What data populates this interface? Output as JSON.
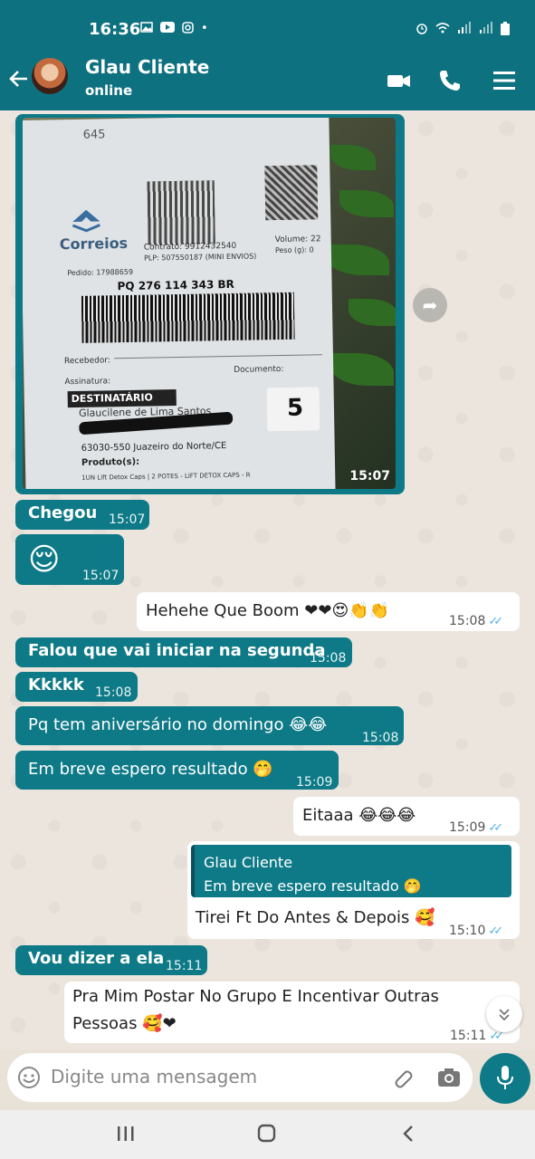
{
  "status_bar": {
    "time": "16:36",
    "notif_icons": [
      "image-icon",
      "youtube-icon",
      "instagram-icon"
    ],
    "dot": "•"
  },
  "header": {
    "contact_name": "Glau Cliente",
    "contact_status": "online"
  },
  "image_message": {
    "time": "15:07",
    "label_texts": {
      "brand": "Correios",
      "contract": "Contrato: 9912432540",
      "plp": "PLP: 507550187 (MINI ENVIOS)",
      "volume": "Volume: 22",
      "weight": "Peso (g): 0",
      "order": "Pedido: 17988659",
      "tracking": "PQ 276 114 343 BR",
      "recebedor": "Recebedor:",
      "documento": "Documento:",
      "assinatura": "Assinatura:",
      "destinatario": "DESTINATÁRIO",
      "dest_name": "Glaucilene de Lima Santos",
      "cep_city": "63030-550 Juazeiro do Norte/CE",
      "produtos": "Produto(s):",
      "product_line": "1UN Lift Detox Caps | 2 POTES - LIFT DETOX CAPS - R",
      "number": "5",
      "handwritten": "645"
    }
  },
  "messages": [
    {
      "id": "m1",
      "dir": "in",
      "text": "Chegou",
      "time": "15:07"
    },
    {
      "id": "m2",
      "dir": "in",
      "text": "😌",
      "time": "15:07"
    },
    {
      "id": "m3",
      "dir": "out",
      "text": "Hehehe Que Boom ❤❤😍👏👏",
      "time": "15:08"
    },
    {
      "id": "m4",
      "dir": "in",
      "text": "Falou que vai iniciar na segunda",
      "time": "15:08"
    },
    {
      "id": "m5",
      "dir": "in",
      "text": "Kkkkk",
      "time": "15:08"
    },
    {
      "id": "m6",
      "dir": "in",
      "text": "Pq tem aniversário no domingo 😂😂",
      "time": "15:08"
    },
    {
      "id": "m7",
      "dir": "in",
      "text": "Em breve espero resultado 🤭",
      "time": "15:09"
    },
    {
      "id": "m8",
      "dir": "out",
      "text": "Eitaaa 😂😂😂",
      "time": "15:09"
    },
    {
      "id": "m9",
      "dir": "out",
      "quote_author": "Glau Cliente",
      "quote_text": "Em breve espero resultado 🤭",
      "text": "Tirei Ft Do Antes & Depois 🥰",
      "time": "15:10"
    },
    {
      "id": "m10",
      "dir": "in",
      "text": "Vou dizer a ela",
      "time": "15:11"
    },
    {
      "id": "m11",
      "dir": "out",
      "line1": "Pra Mim Postar No Grupo E Incentivar Outras",
      "line2": "Pessoas 🥰❤",
      "time": "15:11"
    }
  ],
  "input": {
    "placeholder": "Digite uma mensagem"
  },
  "colors": {
    "teal": "#0e7180",
    "bubble_in": "#0e7a87",
    "bubble_out": "#ffffff",
    "tick": "#4fb3e8"
  }
}
